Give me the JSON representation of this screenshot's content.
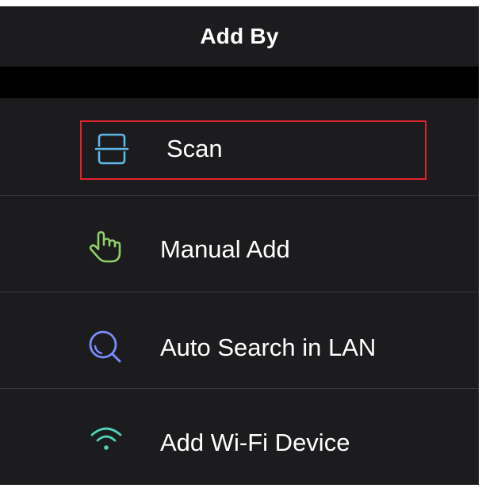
{
  "header": {
    "title": "Add By"
  },
  "options": [
    {
      "label": "Scan",
      "icon": "scan-icon",
      "color": "#5fb8e8"
    },
    {
      "label": "Manual Add",
      "icon": "hand-pointer-icon",
      "color": "#8fd06a"
    },
    {
      "label": "Auto Search in LAN",
      "icon": "search-icon",
      "color": "#7b8cff"
    },
    {
      "label": "Add Wi-Fi Device",
      "icon": "wifi-icon",
      "color": "#4fd1b8"
    }
  ],
  "colors": {
    "background": "#1c1c1e",
    "band": "#000000",
    "highlight": "#e0242b"
  }
}
